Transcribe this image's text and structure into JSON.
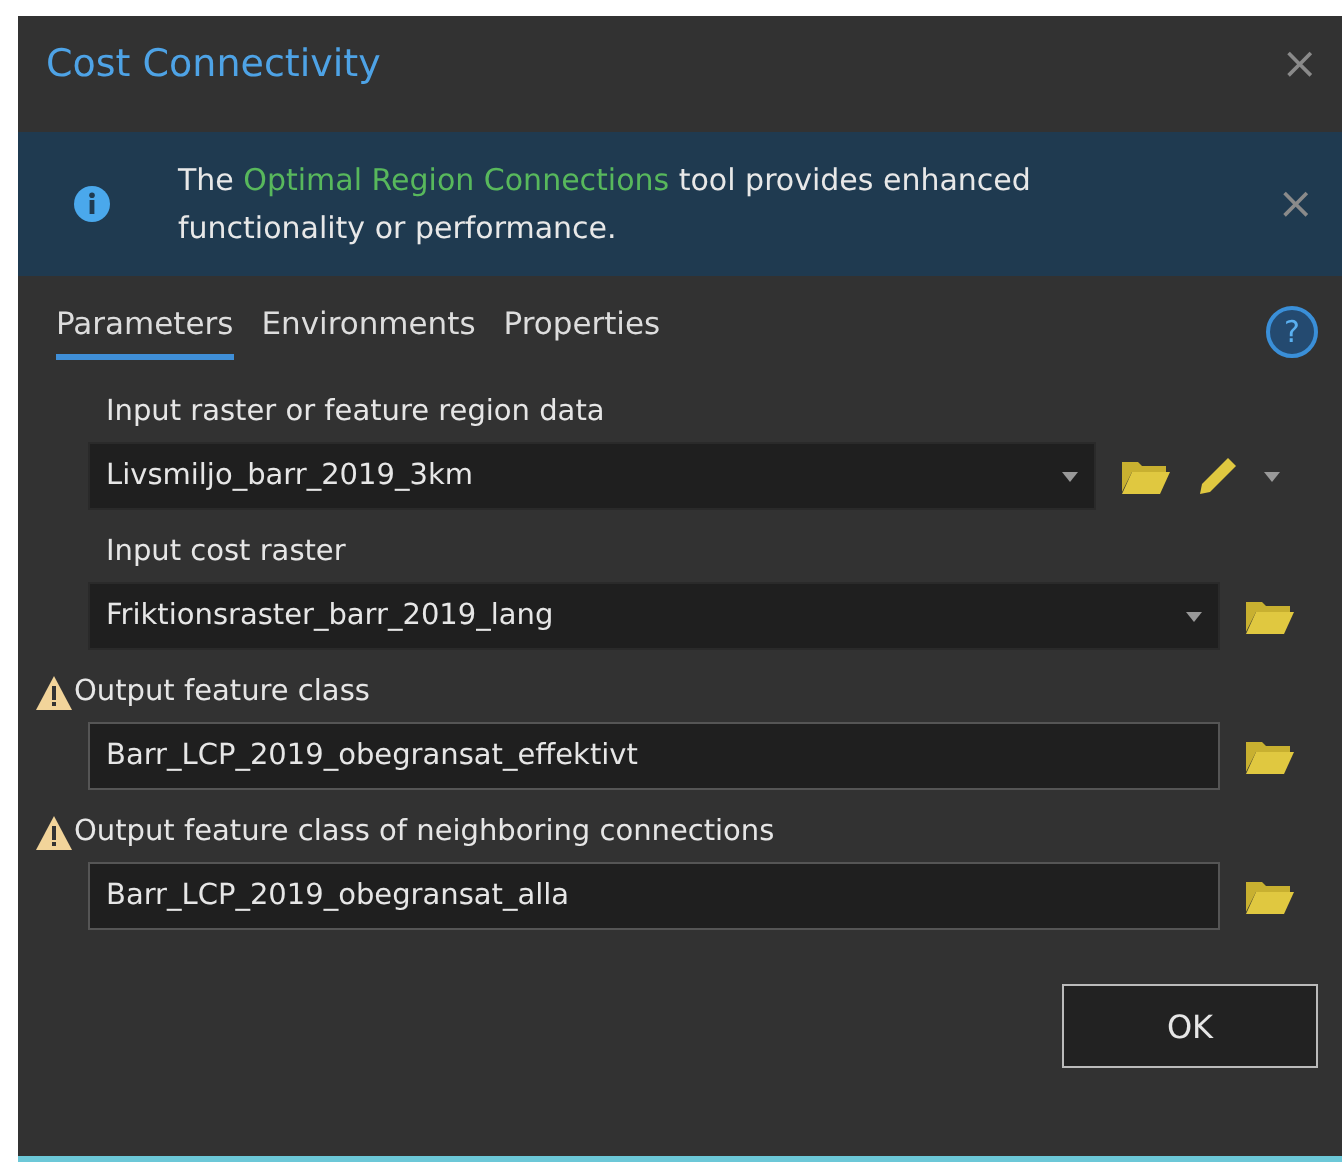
{
  "window": {
    "title": "Cost Connectivity",
    "close": "×"
  },
  "banner": {
    "text_before": "The ",
    "link": "Optimal Region Connections",
    "text_after": " tool provides enhanced functionality or performance.",
    "close": "×"
  },
  "tabs": [
    {
      "label": "Parameters",
      "selected": true
    },
    {
      "label": "Environments",
      "selected": false
    },
    {
      "label": "Properties",
      "selected": false
    }
  ],
  "help": "?",
  "parameters": [
    {
      "label": "Input raster or feature region data",
      "value": "Livsmiljo_barr_2019_3km",
      "kind": "dropdown",
      "warning": false,
      "edit": true
    },
    {
      "label": "Input cost raster",
      "value": "Friktionsraster_barr_2019_lang",
      "kind": "dropdown",
      "warning": false,
      "edit": false
    },
    {
      "label": "Output feature class",
      "value": "Barr_LCP_2019_obegransat_effektivt",
      "kind": "text",
      "warning": true,
      "edit": false
    },
    {
      "label": "Output feature class of neighboring connections",
      "value": "Barr_LCP_2019_obegransat_alla",
      "kind": "text",
      "warning": true,
      "edit": false
    }
  ],
  "buttons": [
    "OK"
  ]
}
